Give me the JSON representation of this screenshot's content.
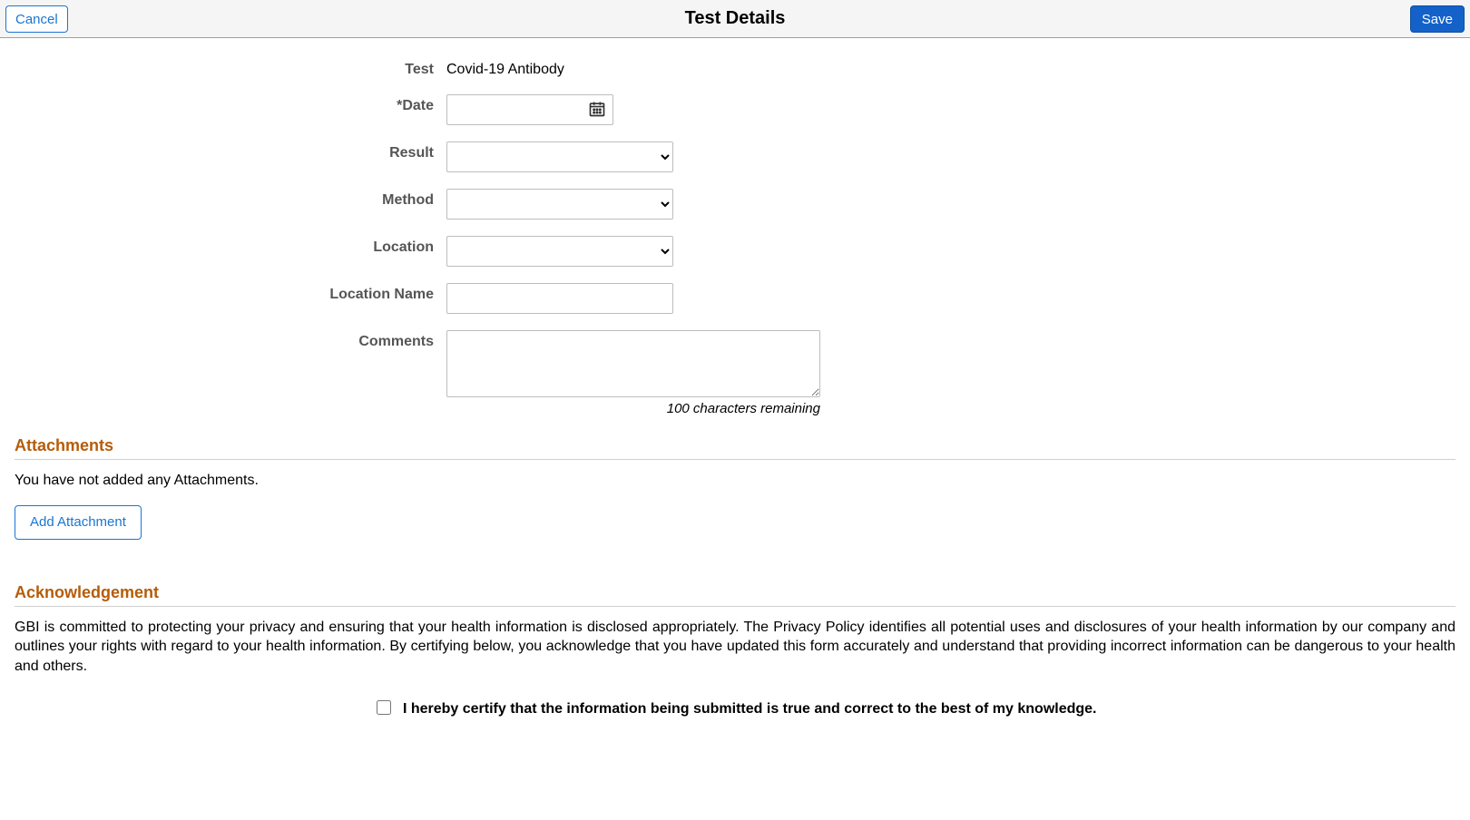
{
  "header": {
    "cancel": "Cancel",
    "title": "Test Details",
    "save": "Save"
  },
  "form": {
    "test_label": "Test",
    "test_value": "Covid-19 Antibody",
    "date_label": "*Date",
    "date_value": "",
    "result_label": "Result",
    "result_value": "",
    "method_label": "Method",
    "method_value": "",
    "location_label": "Location",
    "location_value": "",
    "location_name_label": "Location Name",
    "location_name_value": "",
    "comments_label": "Comments",
    "comments_value": "",
    "char_remaining": "100 characters remaining"
  },
  "attachments": {
    "heading": "Attachments",
    "empty_text": "You have not added any Attachments.",
    "add_button": "Add Attachment"
  },
  "acknowledgement": {
    "heading": "Acknowledgement",
    "body": "GBI is committed to protecting your privacy and ensuring that your health information is disclosed appropriately. The Privacy Policy identifies all potential uses and disclosures of your health information by our company and outlines your rights with regard to your health information. By certifying below, you acknowledge that you have updated this form accurately and understand that providing incorrect information can be dangerous to your health and others.",
    "certify_label": "I hereby certify that the information being submitted is true and correct to the best of my knowledge."
  }
}
